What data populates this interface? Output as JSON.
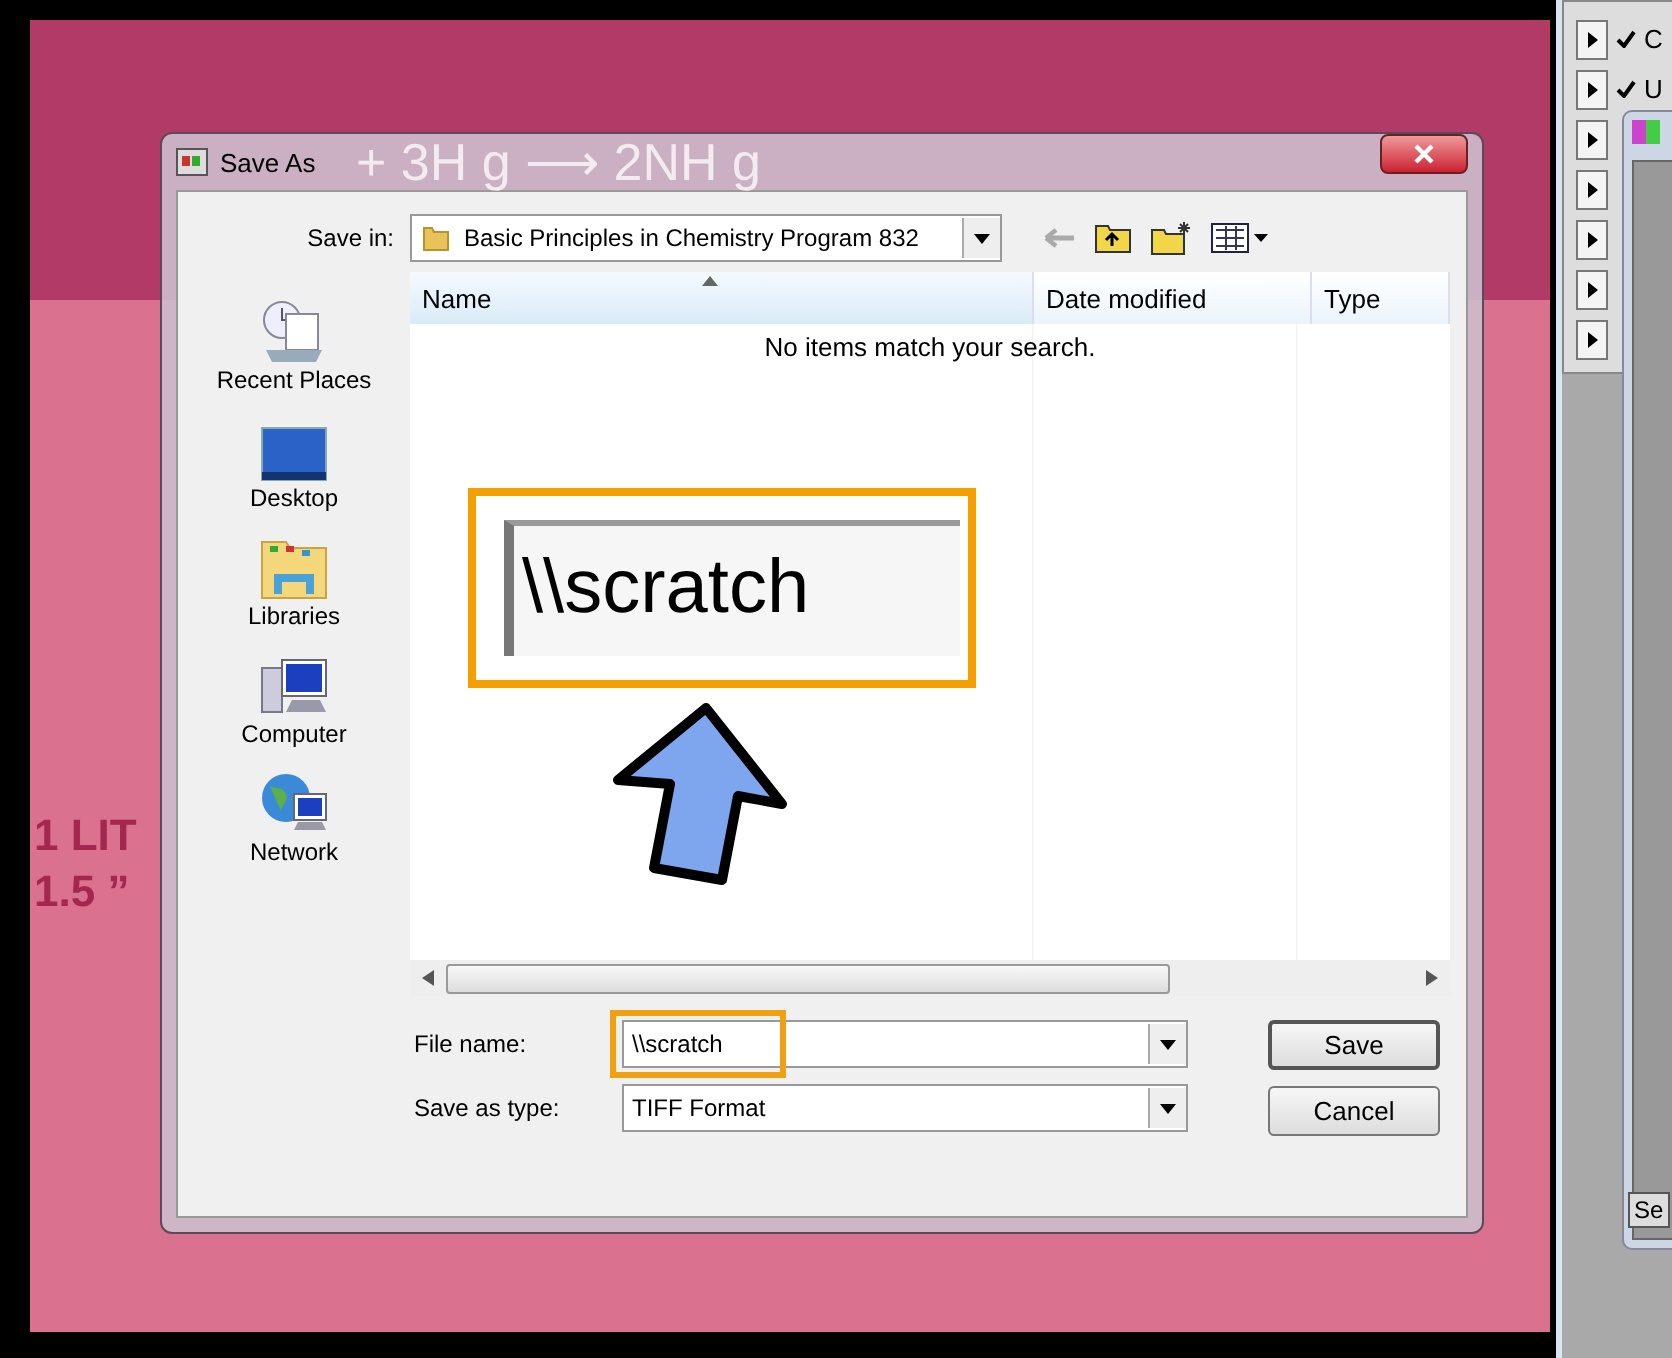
{
  "backdrop": {
    "texts": [
      "1 LIT",
      "1.5 ”"
    ]
  },
  "dialog": {
    "title": "Save As",
    "title_backdrop_text": "+ 3H  g ⟶ 2NH  g",
    "save_in": {
      "label": "Save in:",
      "value": "Basic Principles in Chemistry Program 832"
    },
    "places": [
      {
        "label": "Recent Places",
        "kind": "recent"
      },
      {
        "label": "Desktop",
        "kind": "desktop"
      },
      {
        "label": "Libraries",
        "kind": "libraries"
      },
      {
        "label": "Computer",
        "kind": "computer"
      },
      {
        "label": "Network",
        "kind": "network"
      }
    ],
    "columns": [
      {
        "label": "Name",
        "sorted": true
      },
      {
        "label": "Date modified",
        "sorted": false
      },
      {
        "label": "Type",
        "sorted": false
      }
    ],
    "empty_message": "No items match your search.",
    "file_name": {
      "label": "File name:",
      "value": "\\\\scratch"
    },
    "save_type": {
      "label": "Save as type:",
      "value": "TIFF Format"
    },
    "buttons": [
      "Save",
      "Cancel"
    ]
  },
  "callout": {
    "text": "\\\\scratch"
  },
  "side_panel": {
    "rows": [
      {
        "label": "C",
        "checked": true
      },
      {
        "label": "U",
        "checked": true
      }
    ],
    "tab": "Se"
  }
}
